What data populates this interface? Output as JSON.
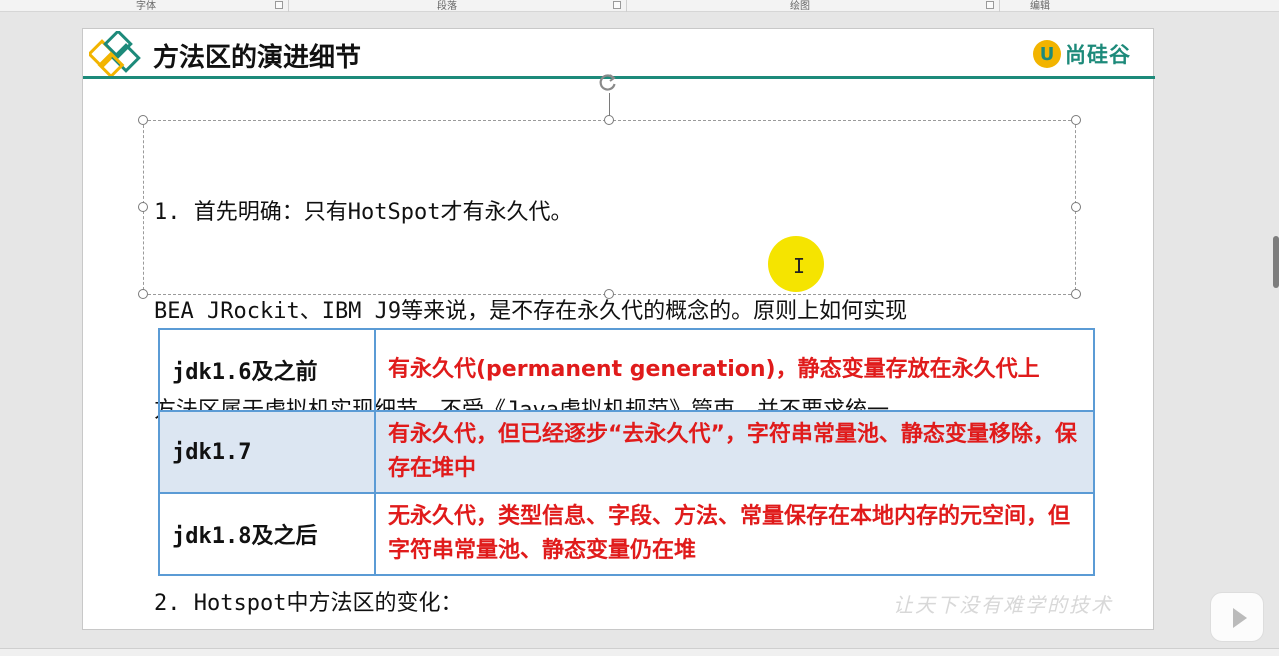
{
  "ribbon": {
    "groups": [
      "字体",
      "段落",
      "绘图",
      "编辑"
    ]
  },
  "slide": {
    "title": "方法区的演进细节",
    "brand": "尚硅谷",
    "textbox": {
      "line1": "1. 首先明确：只有HotSpot才有永久代。",
      "line2": "BEA JRockit、IBM J9等来说，是不存在永久代的概念的。原则上如何实现",
      "line3": "方法区属于虚拟机实现细节，不受《Java虚拟机规范》管束，并不要求统一。",
      "line4": "2. Hotspot中方法区的变化："
    },
    "table": {
      "rows": [
        {
          "version": "jdk1.6及之前",
          "desc": "有永久代(permanent generation)，静态变量存放在永久代上"
        },
        {
          "version": "jdk1.7",
          "desc": "有永久代，但已经逐步“去永久代”，字符串常量池、静态变量移除，保存在堆中"
        },
        {
          "version": "jdk1.8及之后",
          "desc": "无永久代，类型信息、字段、方法、常量保存在本地内存的元空间，但字符串常量池、静态变量仍在堆"
        }
      ]
    },
    "watermark": "让天下没有难学的技术"
  },
  "colors": {
    "accent": "#1d8a7a",
    "brand_yellow": "#f2b400",
    "table_border": "#5b9bd5",
    "table_alt_row": "#dce6f2",
    "desc_text": "#e01b1b",
    "pointer": "#f5e400"
  },
  "icons": [
    "diamond-logo-icon",
    "rotate-handle-icon",
    "text-cursor-icon",
    "play-icon"
  ]
}
